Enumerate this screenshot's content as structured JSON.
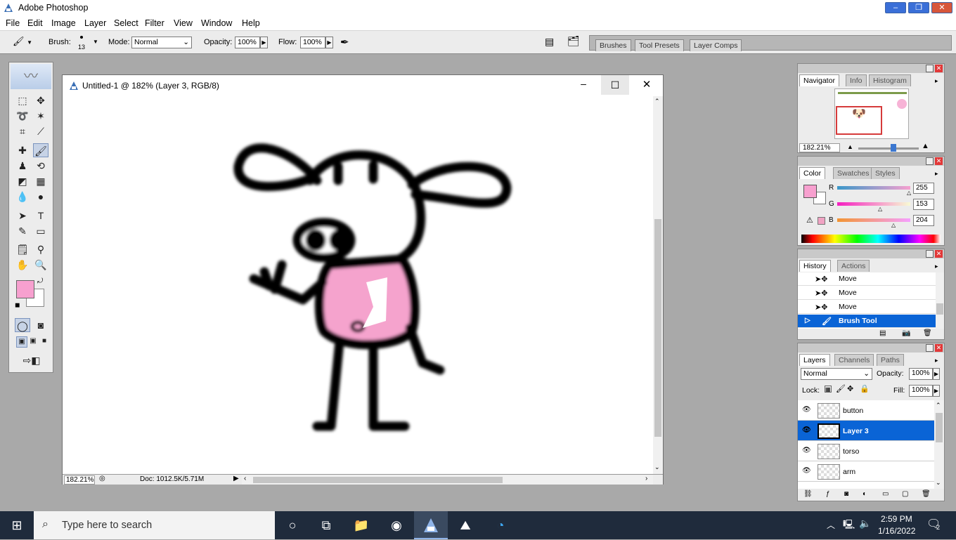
{
  "app": {
    "title": "Adobe Photoshop"
  },
  "menu": [
    "File",
    "Edit",
    "Image",
    "Layer",
    "Select",
    "Filter",
    "View",
    "Window",
    "Help"
  ],
  "options": {
    "brush_label": "Brush:",
    "brush_size": "13",
    "mode_label": "Mode:",
    "mode_value": "Normal",
    "opacity_label": "Opacity:",
    "opacity_value": "100%",
    "flow_label": "Flow:",
    "flow_value": "100%"
  },
  "well_tabs": [
    "Brushes",
    "Tool Presets",
    "Layer Comps"
  ],
  "document": {
    "title": "Untitled-1 @ 182% (Layer 3, RGB/8)",
    "zoom": "182.21%",
    "doc_size": "Doc: 1012.5K/5.71M"
  },
  "navigator": {
    "tabs": [
      "Navigator",
      "Info",
      "Histogram"
    ],
    "zoom": "182.21%"
  },
  "color": {
    "tabs": [
      "Color",
      "Swatches",
      "Styles"
    ],
    "channels": [
      {
        "label": "R",
        "value": "255"
      },
      {
        "label": "G",
        "value": "153"
      },
      {
        "label": "B",
        "value": "204"
      }
    ],
    "foreground": "#f7a0cf",
    "background": "#ffffff"
  },
  "history": {
    "tabs": [
      "History",
      "Actions"
    ],
    "items": [
      "Move",
      "Move",
      "Move",
      "Brush Tool"
    ]
  },
  "layers": {
    "tabs": [
      "Layers",
      "Channels",
      "Paths"
    ],
    "blend_mode": "Normal",
    "opacity_label": "Opacity:",
    "opacity_value": "100%",
    "lock_label": "Lock:",
    "fill_label": "Fill:",
    "fill_value": "100%",
    "items": [
      "button",
      "Layer 3",
      "torso",
      "arm"
    ]
  },
  "taskbar": {
    "search_placeholder": "Type here to search",
    "time": "2:59 PM",
    "date": "1/16/2022",
    "notifications": "2"
  },
  "colors": {
    "accent": "#0a64d6",
    "pink": "#f7a0cf"
  }
}
